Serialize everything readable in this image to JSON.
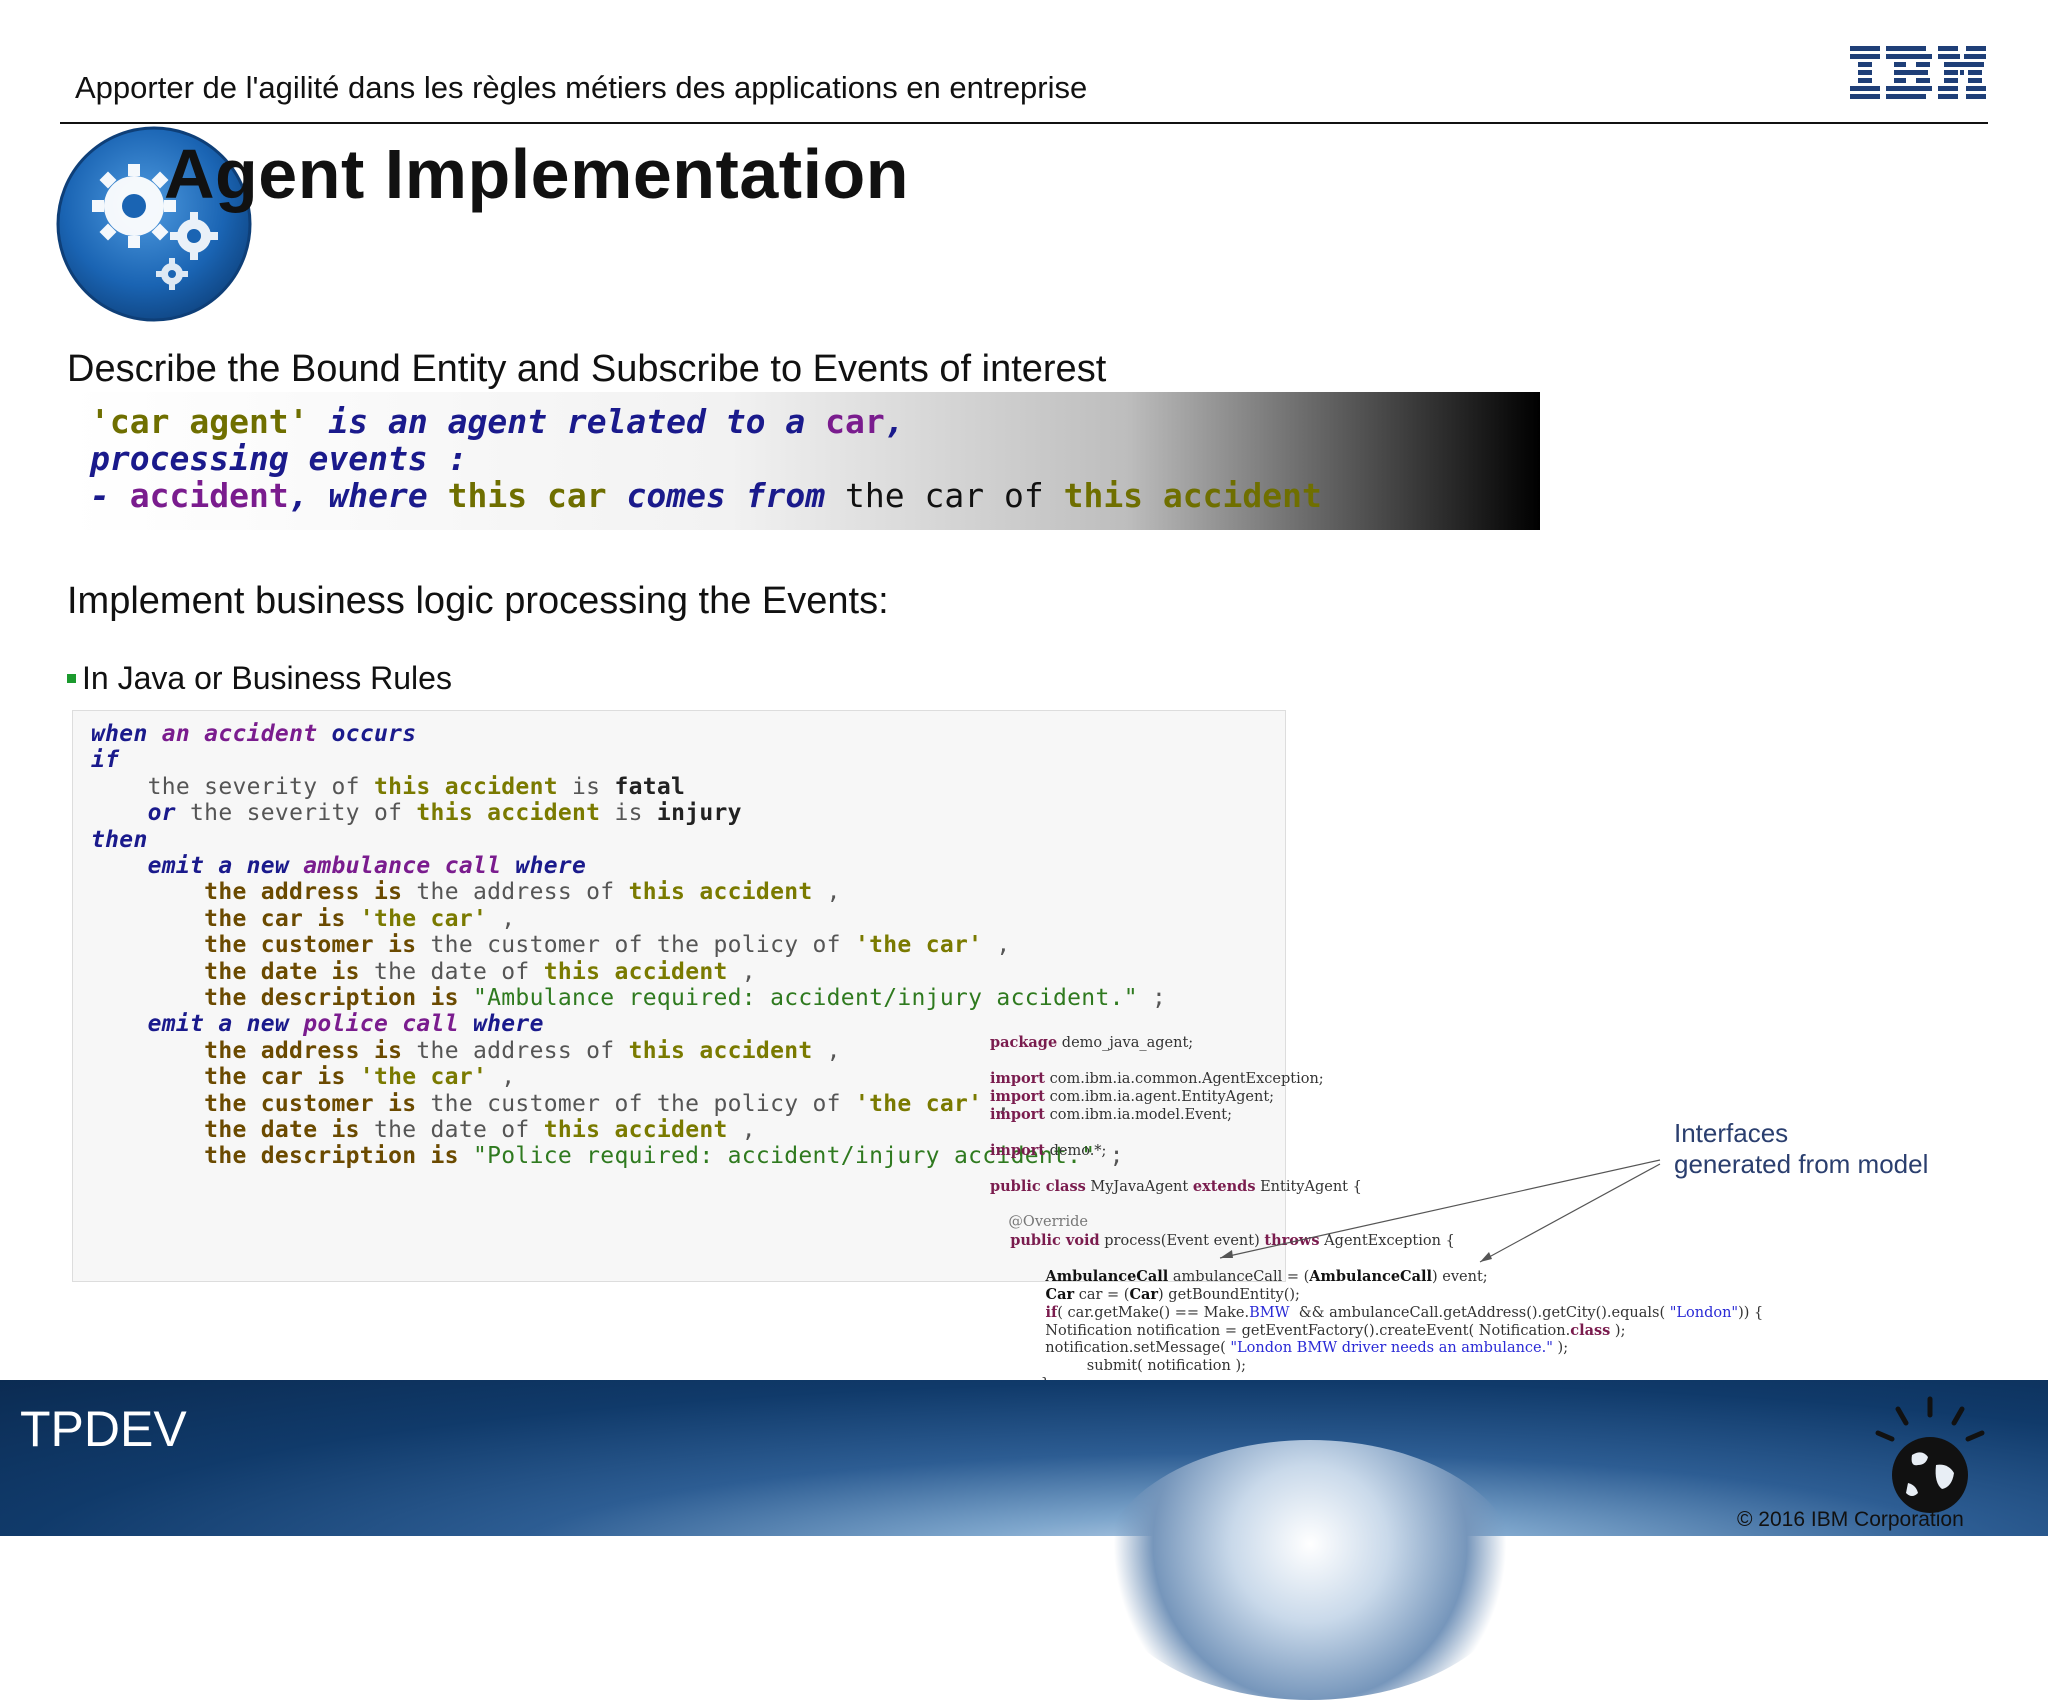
{
  "header": {
    "title": "Apporter de l'agilité dans les règles métiers des applications en entreprise",
    "logo_text": "IBM"
  },
  "slide": {
    "title": "Agent Implementation",
    "subheading_1": "Describe the Bound Entity and Subscribe to Events of interest",
    "subheading_2": "Implement business logic processing the Events:",
    "bullet_1": "In Java or Business Rules"
  },
  "bal_lines": [
    [
      [
        "b-olive",
        "'car agent'"
      ],
      [
        "b-navy",
        " is an agent related to a "
      ],
      [
        "b-purple",
        "car"
      ],
      [
        "b-navy",
        ","
      ]
    ],
    [
      [
        "b-navy",
        "processing events :"
      ]
    ],
    [
      [
        "b-navy",
        "- "
      ],
      [
        "b-purple",
        "accident"
      ],
      [
        "b-navy",
        ", where "
      ],
      [
        "b-olive",
        "this car"
      ],
      [
        "b-navy",
        " comes from "
      ],
      [
        "b-black",
        "the car of "
      ],
      [
        "b-olive",
        "this accident"
      ]
    ]
  ],
  "rule_lines": [
    [
      [
        "kw-navy",
        "when"
      ],
      [
        "kw-purple",
        " an accident"
      ],
      [
        "kw-navy",
        " occurs"
      ]
    ],
    [
      [
        "kw-navy",
        "if"
      ]
    ],
    [
      [
        "txt-gray",
        "    the severity of "
      ],
      [
        "kw-olive",
        "this accident"
      ],
      [
        "txt-gray",
        " is "
      ],
      [
        "txt-dark",
        "fatal"
      ]
    ],
    [
      [
        "kw-navy",
        "    or"
      ],
      [
        "txt-gray",
        " the severity of "
      ],
      [
        "kw-olive",
        "this accident"
      ],
      [
        "txt-gray",
        " is "
      ],
      [
        "txt-dark",
        "injury"
      ]
    ],
    [
      [
        "kw-navy",
        "then"
      ]
    ],
    [
      [
        "kw-navy",
        "    emit a new "
      ],
      [
        "kw-purple",
        "ambulance call"
      ],
      [
        "kw-navy",
        " where"
      ]
    ],
    [
      [
        "kw-brown",
        "        the address is"
      ],
      [
        "txt-gray",
        " the address of "
      ],
      [
        "kw-olive",
        "this accident"
      ],
      [
        "txt-gray",
        " ,"
      ]
    ],
    [
      [
        "kw-brown",
        "        the car is"
      ],
      [
        "kw-olive",
        " 'the car'"
      ],
      [
        "txt-gray",
        " ,"
      ]
    ],
    [
      [
        "kw-brown",
        "        the customer is"
      ],
      [
        "txt-gray",
        " the customer of the policy of "
      ],
      [
        "kw-olive",
        "'the car'"
      ],
      [
        "txt-gray",
        " ,"
      ]
    ],
    [
      [
        "kw-brown",
        "        the date is"
      ],
      [
        "txt-gray",
        " the date of "
      ],
      [
        "kw-olive",
        "this accident"
      ],
      [
        "txt-gray",
        " ,"
      ]
    ],
    [
      [
        "kw-brown",
        "        the description is"
      ],
      [
        "str-green",
        " \"Ambulance required: accident/injury accident.\""
      ],
      [
        "txt-gray",
        " ;"
      ]
    ],
    [
      [
        "kw-navy",
        "    emit a new "
      ],
      [
        "kw-purple",
        "police call"
      ],
      [
        "kw-navy",
        " where"
      ]
    ],
    [
      [
        "kw-brown",
        "        the address is"
      ],
      [
        "txt-gray",
        " the address of "
      ],
      [
        "kw-olive",
        "this accident"
      ],
      [
        "txt-gray",
        " ,"
      ]
    ],
    [
      [
        "kw-brown",
        "        the car is"
      ],
      [
        "kw-olive",
        " 'the car'"
      ],
      [
        "txt-gray",
        " ,"
      ]
    ],
    [
      [
        "kw-brown",
        "        the customer is"
      ],
      [
        "txt-gray",
        " the customer of the policy of "
      ],
      [
        "kw-olive",
        "'the car'"
      ],
      [
        "txt-gray",
        " ,"
      ]
    ],
    [
      [
        "kw-brown",
        "        the date is"
      ],
      [
        "txt-gray",
        " the date of "
      ],
      [
        "kw-olive",
        "this accident"
      ],
      [
        "txt-gray",
        " ,"
      ]
    ],
    [
      [
        "kw-brown",
        "        the description is"
      ],
      [
        "str-green",
        " \"Police required: accident/injury accident.\""
      ],
      [
        "txt-gray",
        " ;"
      ]
    ]
  ],
  "java_lines": [
    [
      [
        "j-kw",
        "package"
      ],
      [
        "java-plain",
        " demo_java_agent;"
      ]
    ],
    [],
    [
      [
        "j-kw",
        "import"
      ],
      [
        "java-plain",
        " com.ibm.ia.common.AgentException;"
      ]
    ],
    [
      [
        "j-kw",
        "import"
      ],
      [
        "java-plain",
        " com.ibm.ia.agent.EntityAgent;"
      ]
    ],
    [
      [
        "j-kw",
        "import"
      ],
      [
        "java-plain",
        " com.ibm.ia.model.Event;"
      ]
    ],
    [],
    [
      [
        "j-kw",
        "import"
      ],
      [
        "java-plain",
        " demo.*;"
      ]
    ],
    [],
    [
      [
        "j-kw",
        "public class"
      ],
      [
        "java-plain",
        " MyJavaAgent "
      ],
      [
        "j-kw",
        "extends"
      ],
      [
        "java-plain",
        " EntityAgent {"
      ]
    ],
    [],
    [
      [
        "j-ann",
        "    @Override"
      ]
    ],
    [
      [
        "j-kw",
        "    public void"
      ],
      [
        "java-plain",
        " process(Event event) "
      ],
      [
        "j-kw",
        "throws"
      ],
      [
        "java-plain",
        " AgentException {"
      ]
    ],
    [],
    [
      [
        "j-bold",
        "           AmbulanceCall"
      ],
      [
        "java-plain",
        " ambulanceCall = ("
      ],
      [
        "j-bold",
        "AmbulanceCall"
      ],
      [
        "java-plain",
        ") event;"
      ]
    ],
    [
      [
        "j-bold",
        "           Car"
      ],
      [
        "java-plain",
        " car = ("
      ],
      [
        "j-bold",
        "Car"
      ],
      [
        "java-plain",
        ") getBoundEntity();"
      ]
    ],
    [
      [
        "j-kw",
        "           if"
      ],
      [
        "java-plain",
        "( car.getMake() == Make."
      ],
      [
        "j-str",
        "BMW"
      ],
      [
        "java-plain",
        "  && ambulanceCall.getAddress().getCity().equals( "
      ],
      [
        "j-str",
        "\"London\""
      ],
      [
        "java-plain",
        ")) {"
      ]
    ],
    [
      [
        "java-plain",
        "            Notification notification = getEventFactory().createEvent( Notification."
      ],
      [
        "j-kw",
        "class"
      ],
      [
        "java-plain",
        " );"
      ]
    ],
    [
      [
        "java-plain",
        "            notification.setMessage( "
      ],
      [
        "j-str",
        "\"London BMW driver needs an ambulance.\""
      ],
      [
        "java-plain",
        " );"
      ]
    ],
    [
      [
        "java-plain",
        "                     submit( notification );"
      ]
    ],
    [
      [
        "java-plain",
        "           }"
      ]
    ],
    [
      [
        "java-plain",
        "    }"
      ]
    ],
    [
      [
        "java-plain",
        "}"
      ]
    ]
  ],
  "callout": {
    "line1": "Interfaces",
    "line2": "generated from model"
  },
  "footer": {
    "label": "TPDEV",
    "copyright": "© 2016 IBM Corporation"
  },
  "colors": {
    "ibm_blue": "#1f3f78",
    "bullet_green": "#1b9a2e",
    "callout_text": "#2a3e6e"
  },
  "icons": {
    "badge": "gears-icon",
    "brand": "ibm-logo",
    "footer": "smarter-planet-icon"
  }
}
